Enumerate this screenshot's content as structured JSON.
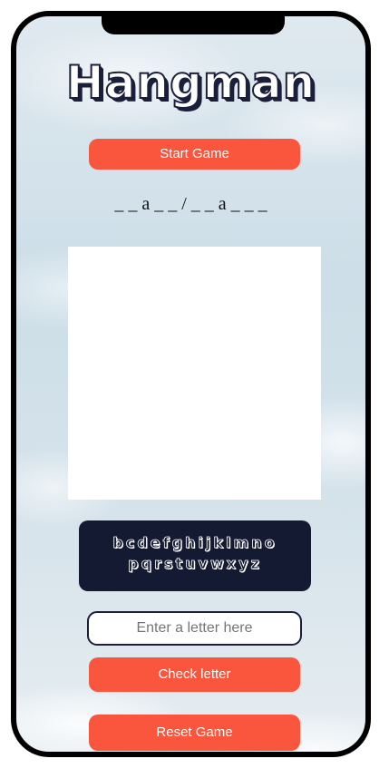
{
  "app": {
    "title": "Hangman"
  },
  "buttons": {
    "start_label": "Start Game",
    "check_label": "Check letter",
    "reset_label": "Reset Game"
  },
  "game": {
    "word_display": "_ _ a _ _ / _ _ a _ _ _"
  },
  "alphabet": {
    "row1": "bcdefghijklmno",
    "row2": "pqrstuvwxyz"
  },
  "input": {
    "placeholder": "Enter a letter here",
    "value": ""
  },
  "colors": {
    "accent": "#fa553d",
    "dark": "#141a32",
    "frame": "#000000"
  }
}
